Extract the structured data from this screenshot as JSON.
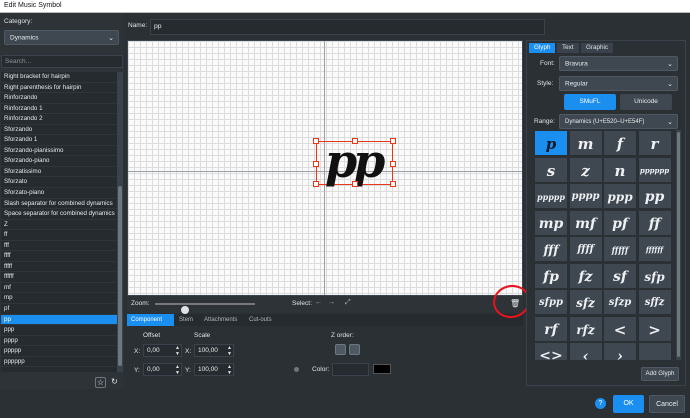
{
  "window": {
    "title": "Edit Music Symbol"
  },
  "left_panel": {
    "category_label": "Category:",
    "category_value": "Dynamics",
    "search_placeholder": "Search...",
    "items": [
      "Right bracket for hairpin",
      "Right parenthesis for hairpin",
      "Rinforzando",
      "Rinforzando 1",
      "Rinforzando 2",
      "Sforzando",
      "Sforzando 1",
      "Sforzando-pianissimo",
      "Sforzando-piano",
      "Sforzatissimo",
      "Sforzato",
      "Sforzato-piano",
      "Slash separator for combined dynamics",
      "Space separator for combined dynamics",
      "Z",
      "ff",
      "fff",
      "ffff",
      "fffff",
      "ffffff",
      "mf",
      "mp",
      "pf",
      "pp",
      "ppp",
      "pppp",
      "ppppp",
      "pppppp"
    ],
    "selected_item": "pp",
    "favorite_icon": "star-icon",
    "reset_icon": "reset-icon"
  },
  "name_field": {
    "label": "Name:",
    "value": "pp"
  },
  "canvas": {
    "glyph_text": "pp"
  },
  "canvas_toolbar": {
    "zoom_label": "Zoom:",
    "zoom_level": 0.3,
    "select_label": "Select:",
    "prev_glyph": "←",
    "next_glyph": "→",
    "expand_glyph": "⤢"
  },
  "bottom_tabs": [
    "Component",
    "Stem",
    "Attachments",
    "Cut-outs"
  ],
  "active_bottom_tab": "Component",
  "properties": {
    "offset_label": "Offset",
    "scale_label": "Scale",
    "x_label": "X:",
    "y_label": "Y:",
    "offset_x": "0,00",
    "offset_y": "0,00",
    "scale_x": "100,00",
    "scale_y": "100,00",
    "zorder_label": "Z order:",
    "color_label": "Color:",
    "color_value": "#000000"
  },
  "right_panel": {
    "tabs": [
      "Glyph",
      "Text",
      "Graphic"
    ],
    "active_tab": "Glyph",
    "font_label": "Font:",
    "font_value": "Bravura",
    "style_label": "Style:",
    "style_value": "Regular",
    "seg_smufl": "SMuFL",
    "seg_unicode": "Unicode",
    "range_label": "Range:",
    "range_value": "Dynamics (U+E520–U+E54F)",
    "glyphs": [
      "p",
      "m",
      "f",
      "r",
      "s",
      "z",
      "n",
      "pppppp",
      "ppppp",
      "pppp",
      "ppp",
      "pp",
      "mp",
      "mf",
      "pf",
      "ff",
      "fff",
      "ffff",
      "fffff",
      "ffffff",
      "fp",
      "fz",
      "sf",
      "sfp",
      "sfpp",
      "sfz",
      "sfzp",
      "sffz",
      "rf",
      "rfz",
      "<",
      ">",
      "<>",
      "‹",
      "›",
      ""
    ],
    "selected_glyph": "p",
    "add_glyph_label": "Add Glyph"
  },
  "footer": {
    "help_label": "?",
    "ok_label": "OK",
    "cancel_label": "Cancel"
  },
  "colors": {
    "accent": "#1a8ff0",
    "annotation": "#e8131d",
    "selection_box": "#e8381a"
  }
}
